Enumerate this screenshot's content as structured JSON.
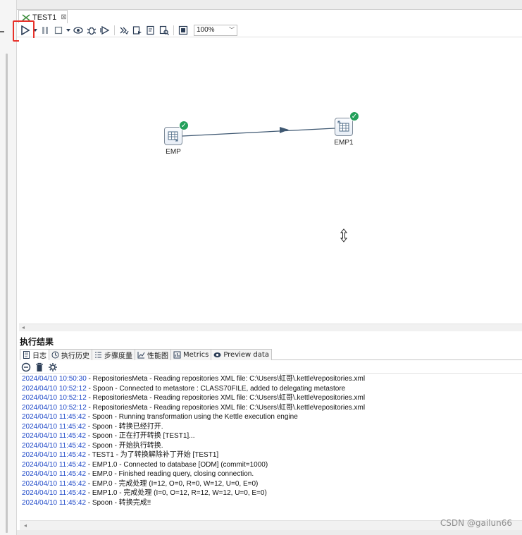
{
  "tab": {
    "title": "TEST1",
    "close_glyph": "⊠"
  },
  "toolbar": {
    "zoom": "100%"
  },
  "nodes": [
    {
      "label": "EMP"
    },
    {
      "label": "EMP1"
    }
  ],
  "results": {
    "title": "执行结果",
    "tabs": [
      {
        "label": "日志",
        "icon": "log-icon"
      },
      {
        "label": "执行历史",
        "icon": "history-icon"
      },
      {
        "label": "步骤度量",
        "icon": "metrics-list-icon"
      },
      {
        "label": "性能图",
        "icon": "chart-icon"
      },
      {
        "label": "Metrics",
        "icon": "metrics-icon"
      },
      {
        "label": "Preview data",
        "icon": "eye-icon"
      }
    ],
    "log_lines": [
      {
        "ts": "2024/04/10 10:50:30",
        "msg": " - RepositoriesMeta - Reading repositories XML file: C:\\Users\\虹哥\\.kettle\\repositories.xml"
      },
      {
        "ts": "2024/04/10 10:52:12",
        "msg": " - Spoon - Connected to metastore : CLASS70FILE, added to delegating metastore"
      },
      {
        "ts": "2024/04/10 10:52:12",
        "msg": " - RepositoriesMeta - Reading repositories XML file: C:\\Users\\虹哥\\.kettle\\repositories.xml"
      },
      {
        "ts": "2024/04/10 10:52:12",
        "msg": " - RepositoriesMeta - Reading repositories XML file: C:\\Users\\虹哥\\.kettle\\repositories.xml"
      },
      {
        "ts": "2024/04/10 11:45:42",
        "msg": " - Spoon - Running transformation using the Kettle execution engine"
      },
      {
        "ts": "2024/04/10 11:45:42",
        "msg": " - Spoon - 转换已经打开."
      },
      {
        "ts": "2024/04/10 11:45:42",
        "msg": " - Spoon - 正在打开转换 [TEST1]..."
      },
      {
        "ts": "2024/04/10 11:45:42",
        "msg": " - Spoon - 开始执行转换."
      },
      {
        "ts": "2024/04/10 11:45:42",
        "msg": " - TEST1 - 为了转换解除补丁开始  [TEST1]"
      },
      {
        "ts": "2024/04/10 11:45:42",
        "msg": " - EMP1.0 - Connected to database [ODM] (commit=1000)"
      },
      {
        "ts": "2024/04/10 11:45:42",
        "msg": " - EMP.0 - Finished reading query, closing connection."
      },
      {
        "ts": "2024/04/10 11:45:42",
        "msg": " - EMP.0 - 完成处理 (I=12, O=0, R=0, W=12, U=0, E=0)"
      },
      {
        "ts": "2024/04/10 11:45:42",
        "msg": " - EMP1.0 - 完成处理 (I=0, O=12, R=12, W=12, U=0, E=0)"
      },
      {
        "ts": "2024/04/10 11:45:42",
        "msg": " - Spoon - 转换完成!!"
      }
    ]
  },
  "watermark": "CSDN @gailun66",
  "colors": {
    "highlight": "#e8312a",
    "timestamp": "#1f49c8",
    "success": "#23a05a",
    "hop": "#3f5872"
  }
}
